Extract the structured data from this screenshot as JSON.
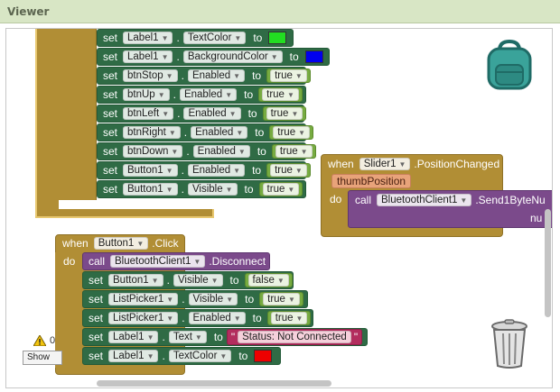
{
  "viewer": {
    "title": "Viewer"
  },
  "blocks": {
    "kw_set": "set",
    "kw_to": "to",
    "kw_dot": ".",
    "kw_when": "when",
    "kw_do": "do",
    "kw_call": "call",
    "val_true": "true",
    "val_false": "false",
    "top_rows": [
      {
        "component": "Label1",
        "property": "TextColor",
        "value_type": "color",
        "color": "#22dd22"
      },
      {
        "component": "Label1",
        "property": "BackgroundColor",
        "value_type": "color",
        "color": "#0000ee"
      },
      {
        "component": "btnStop",
        "property": "Enabled",
        "value": "true"
      },
      {
        "component": "btnUp",
        "property": "Enabled",
        "value": "true"
      },
      {
        "component": "btnLeft",
        "property": "Enabled",
        "value": "true"
      },
      {
        "component": "btnRight",
        "property": "Enabled",
        "value": "true"
      },
      {
        "component": "btnDown",
        "property": "Enabled",
        "value": "true"
      },
      {
        "component": "Button1",
        "property": "Enabled",
        "value": "true"
      },
      {
        "component": "Button1",
        "property": "Visible",
        "value": "true"
      }
    ],
    "slider_event": {
      "component": "Slider1",
      "event": ".PositionChanged",
      "param": "thumbPosition",
      "call_component": "BluetoothClient1",
      "call_method": ".Send1ByteNu",
      "arg_label": "nu"
    },
    "button_event": {
      "component": "Button1",
      "event": ".Click",
      "call_component": "BluetoothClient1",
      "call_method": ".Disconnect",
      "rows": [
        {
          "component": "Button1",
          "property": "Visible",
          "value": "false"
        },
        {
          "component": "ListPicker1",
          "property": "Visible",
          "value": "true"
        },
        {
          "component": "ListPicker1",
          "property": "Enabled",
          "value": "true"
        },
        {
          "component": "Label1",
          "property": "Text",
          "value_type": "text",
          "value": "Status: Not Connected"
        },
        {
          "component": "Label1",
          "property": "TextColor",
          "value_type": "color",
          "color": "#ee0000"
        }
      ]
    }
  },
  "warnings": {
    "count": "0",
    "show_label": "Show"
  },
  "icons": {
    "backpack": "backpack-icon",
    "trash": "trash-icon",
    "warning": "warning-icon"
  },
  "colors": {
    "set_block": "#2f6b45",
    "event_block": "#b18e35",
    "call_block": "#7b4a8b",
    "logic_block": "#77ab41",
    "text_block": "#b32d5e"
  }
}
